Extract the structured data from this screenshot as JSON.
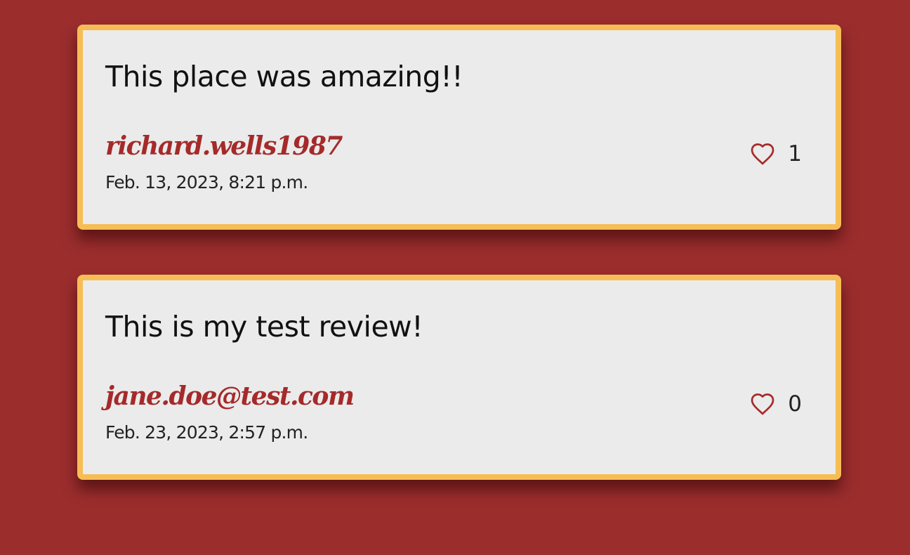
{
  "reviews": [
    {
      "text": "This place was amazing!!",
      "author": "richard.wells1987",
      "date": "Feb. 13, 2023, 8:21 p.m.",
      "likes": "1"
    },
    {
      "text": "This is my test review!",
      "author": "jane.doe@test.com",
      "date": "Feb. 23, 2023, 2:57 p.m.",
      "likes": "0"
    }
  ],
  "colors": {
    "background": "#9b2d2d",
    "card": "#ebebeb",
    "card_border": "#f6bd55",
    "author": "#a52a2a",
    "heart": "#a52a2a"
  },
  "icons": {
    "like": "heart-outline-icon"
  }
}
